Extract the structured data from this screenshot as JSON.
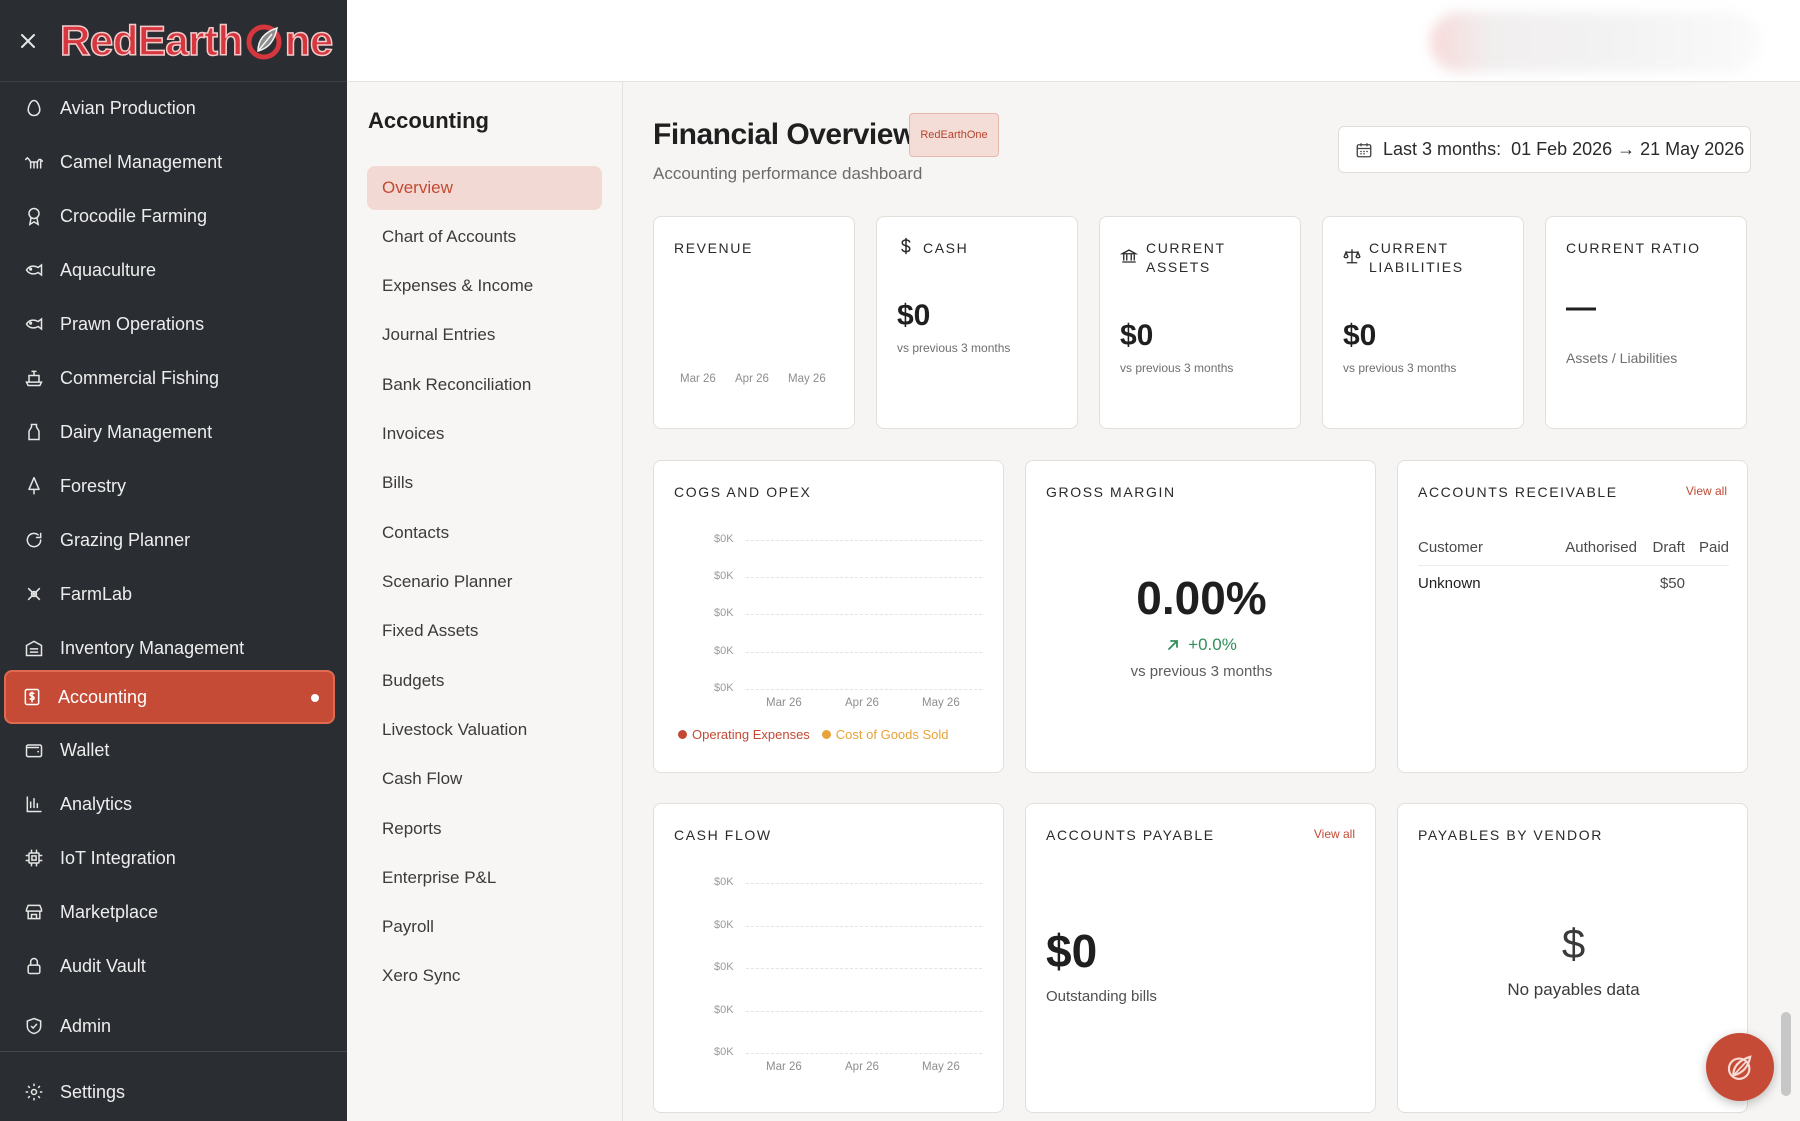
{
  "brand": {
    "logo_text_a": "RedEarth",
    "logo_text_b": "ne"
  },
  "sidebar": {
    "items": [
      {
        "label": "Avian Production",
        "icon": "egg-icon"
      },
      {
        "label": "Camel Management",
        "icon": "camel-icon"
      },
      {
        "label": "Crocodile Farming",
        "icon": "award-icon"
      },
      {
        "label": "Aquaculture",
        "icon": "fish-icon"
      },
      {
        "label": "Prawn Operations",
        "icon": "fish-icon"
      },
      {
        "label": "Commercial Fishing",
        "icon": "ship-icon"
      },
      {
        "label": "Dairy Management",
        "icon": "milk-icon"
      },
      {
        "label": "Forestry",
        "icon": "tree-icon"
      },
      {
        "label": "Grazing Planner",
        "icon": "refresh-icon"
      },
      {
        "label": "FarmLab",
        "icon": "flask-icon"
      },
      {
        "label": "Inventory Management",
        "icon": "warehouse-icon"
      },
      {
        "label": "Accounting",
        "icon": "receipt-dollar-icon",
        "active": true
      },
      {
        "label": "Wallet",
        "icon": "wallet-icon"
      },
      {
        "label": "Analytics",
        "icon": "bar-chart-icon"
      },
      {
        "label": "IoT Integration",
        "icon": "chip-icon"
      },
      {
        "label": "Marketplace",
        "icon": "store-icon"
      },
      {
        "label": "Audit Vault",
        "icon": "lock-icon"
      },
      {
        "label": "Admin",
        "icon": "shield-icon"
      },
      {
        "label": "Settings",
        "icon": "gear-icon"
      }
    ]
  },
  "subnav": {
    "title": "Accounting",
    "items": [
      "Overview",
      "Chart of Accounts",
      "Expenses & Income",
      "Journal Entries",
      "Bank Reconciliation",
      "Invoices",
      "Bills",
      "Contacts",
      "Scenario Planner",
      "Fixed Assets",
      "Budgets",
      "Livestock Valuation",
      "Cash Flow",
      "Reports",
      "Enterprise P&L",
      "Payroll",
      "Xero Sync"
    ],
    "active_index": 0
  },
  "header": {
    "title": "Financial Overview",
    "badge": "RedEarthOne",
    "subtitle": "Accounting performance dashboard",
    "date_label": "Last 3 months:",
    "date_range": "01 Feb 2026 → 21 May 2026"
  },
  "kpis": {
    "revenue": {
      "title": "REVENUE",
      "months": [
        "Mar 26",
        "Apr 26",
        "May 26"
      ]
    },
    "cash": {
      "title": "CASH",
      "value": "$0",
      "sub": "vs previous 3 months"
    },
    "current_assets": {
      "title_1": "CURRENT",
      "title_2": "ASSETS",
      "value": "$0",
      "sub": "vs previous 3 months"
    },
    "current_liabilities": {
      "title_1": "CURRENT",
      "title_2": "LIABILITIES",
      "value": "$0",
      "sub": "vs previous 3 months"
    },
    "current_ratio": {
      "title": "CURRENT RATIO",
      "value": "—",
      "sub": "Assets / Liabilities"
    }
  },
  "cogs": {
    "title": "COGS AND OPEX",
    "y_ticks": [
      "$0K",
      "$0K",
      "$0K",
      "$0K",
      "$0K"
    ],
    "months": [
      "Mar 26",
      "Apr 26",
      "May 26"
    ],
    "legend": [
      {
        "label": "Operating Expenses",
        "color": "#c24a33"
      },
      {
        "label": "Cost of Goods Sold",
        "color": "#e8a23a"
      }
    ]
  },
  "gross_margin": {
    "title": "GROSS MARGIN",
    "value": "0.00%",
    "delta": "+0.0%",
    "sub": "vs previous 3 months",
    "delta_color": "#2f8f5a"
  },
  "receivables": {
    "title": "ACCOUNTS RECEIVABLE",
    "view_all": "View all",
    "columns": [
      "Customer",
      "Authorised",
      "Draft",
      "Paid"
    ],
    "rows": [
      {
        "customer": "Unknown",
        "authorised": "",
        "draft": "$50",
        "paid": ""
      }
    ]
  },
  "cash_flow": {
    "title": "CASH FLOW",
    "y_ticks": [
      "$0K",
      "$0K",
      "$0K",
      "$0K",
      "$0K"
    ],
    "months": [
      "Mar 26",
      "Apr 26",
      "May 26"
    ]
  },
  "payables": {
    "title": "ACCOUNTS PAYABLE",
    "view_all": "View all",
    "value": "$0",
    "sub": "Outstanding bills"
  },
  "payables_vendor": {
    "title": "PAYABLES BY VENDOR",
    "symbol": "$",
    "empty": "No payables data"
  },
  "colors": {
    "accent": "#c64b36",
    "sidebar_bg": "#2a2d31"
  }
}
